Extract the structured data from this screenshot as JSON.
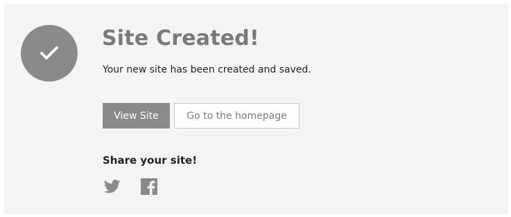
{
  "confirmation": {
    "title": "Site Created!",
    "message": "Your new site has been created and saved.",
    "icon": "checkmark-icon"
  },
  "actions": {
    "view_site_label": "View Site",
    "homepage_label": "Go to the homepage"
  },
  "share": {
    "heading": "Share your site!",
    "icons": [
      "twitter-icon",
      "facebook-icon"
    ]
  },
  "colors": {
    "panel_background": "#f4f4f4",
    "accent_gray": "#8a8a8a",
    "title_gray": "#7a7a7a",
    "text_dark": "#222222"
  }
}
